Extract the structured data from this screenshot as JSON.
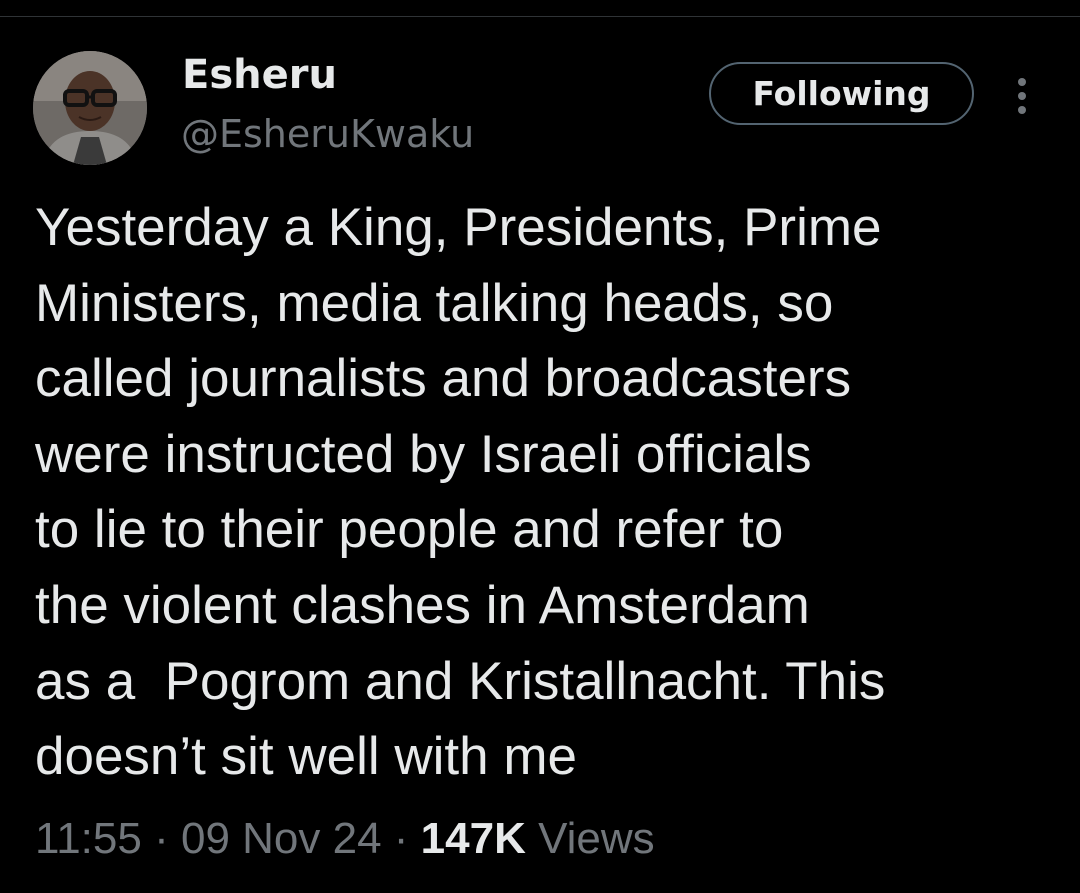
{
  "author": {
    "display_name": "Esheru",
    "handle": "@EsheruKwaku",
    "avatar_icon": "profile-photo"
  },
  "actions": {
    "follow_label": "Following",
    "more_icon": "more-vertical-icon"
  },
  "tweet": {
    "lines": [
      "Yesterday a King, Presidents, Prime",
      "Ministers, media talking heads, so",
      "called journalists and broadcasters",
      "were instructed by Israeli officials",
      "to lie to their people and refer to",
      "the violent clashes in Amsterdam",
      "as a  Pogrom and Kristallnacht. This",
      "doesn’t sit well with me"
    ]
  },
  "meta": {
    "time": "11:55",
    "separator": "·",
    "date": "09 Nov 24",
    "views_count": "147K",
    "views_label": "Views"
  },
  "colors": {
    "background": "#000000",
    "primary_text": "#e7e9ea",
    "secondary_text": "#71767b",
    "button_border": "#536471"
  }
}
